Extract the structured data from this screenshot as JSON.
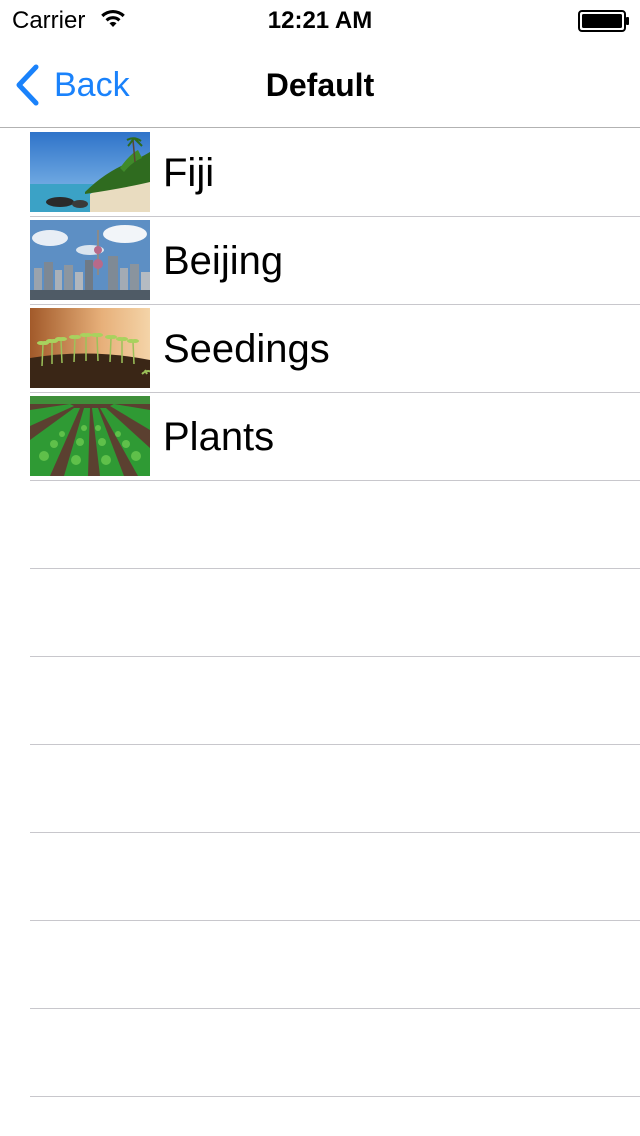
{
  "status_bar": {
    "carrier": "Carrier",
    "time": "12:21 AM",
    "icons": [
      "wifi-icon",
      "battery-icon"
    ]
  },
  "nav_bar": {
    "back_label": "Back",
    "title": "Default",
    "back_icon": "chevron-left-icon"
  },
  "colors": {
    "tint": "#1a82fb",
    "separator": "#c8c7cc"
  },
  "rows": [
    {
      "label": "Fiji",
      "image": "beach-photo"
    },
    {
      "label": "Beijing",
      "image": "city-skyline-photo"
    },
    {
      "label": "Seedings",
      "image": "seedlings-photo"
    },
    {
      "label": "Plants",
      "image": "crop-field-photo"
    }
  ]
}
